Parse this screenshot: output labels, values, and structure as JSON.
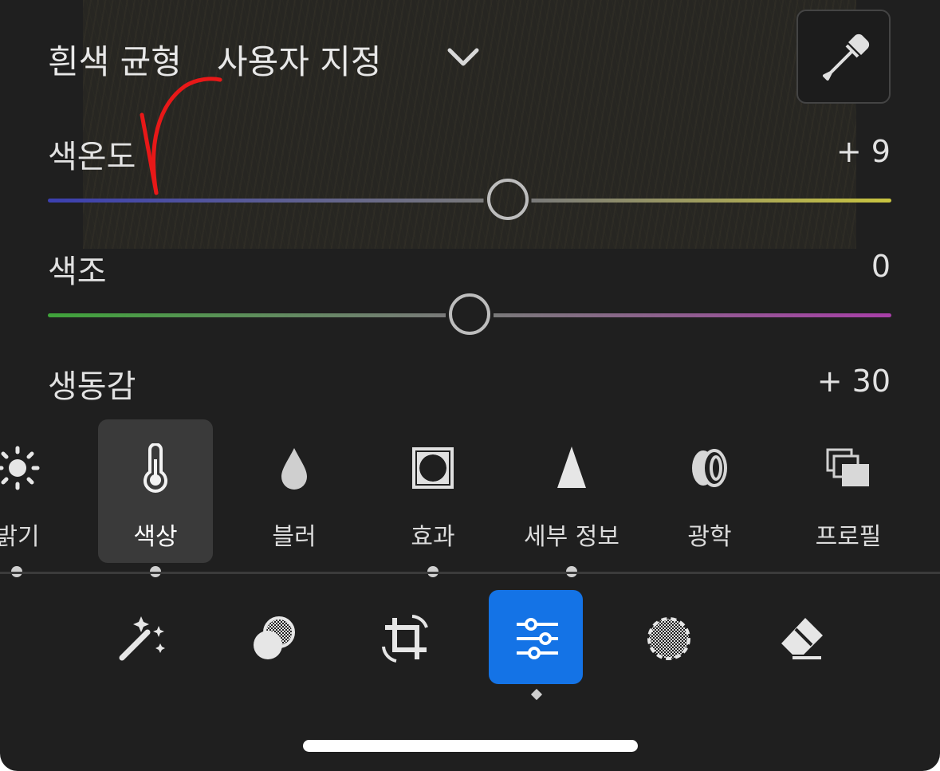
{
  "white_balance": {
    "label": "흰색 균형",
    "value": "사용자 지정",
    "dropdown_icon": "chevron-down-icon",
    "eyedropper_icon": "eyedropper-icon"
  },
  "sliders": [
    {
      "label": "색온도",
      "value": "+ 9",
      "position": 0.545,
      "track_colors": [
        "#3b3fb0",
        "#c9c440"
      ]
    },
    {
      "label": "색조",
      "value": "0",
      "position": 0.5,
      "track_colors": [
        "#3fa33a",
        "#a83fa8"
      ]
    },
    {
      "label": "생동감",
      "value": "+ 30"
    }
  ],
  "tools": [
    {
      "label": "밝기",
      "icon": "sun-icon"
    },
    {
      "label": "색상",
      "icon": "thermometer-icon",
      "selected": true
    },
    {
      "label": "블러",
      "icon": "droplet-icon"
    },
    {
      "label": "효과",
      "icon": "vignette-icon"
    },
    {
      "label": "세부 정보",
      "icon": "triangle-icon"
    },
    {
      "label": "광학",
      "icon": "lens-icon"
    },
    {
      "label": "프로필",
      "icon": "profile-stack-icon"
    }
  ],
  "bottom_nav": [
    {
      "icon": "magic-wand-icon"
    },
    {
      "icon": "heal-icon"
    },
    {
      "icon": "crop-rotate-icon"
    },
    {
      "icon": "adjust-sliders-icon",
      "selected": true
    },
    {
      "icon": "mask-icon"
    },
    {
      "icon": "eraser-icon"
    }
  ],
  "colors": {
    "accent": "#1473e6",
    "background": "#1f1f1f"
  }
}
